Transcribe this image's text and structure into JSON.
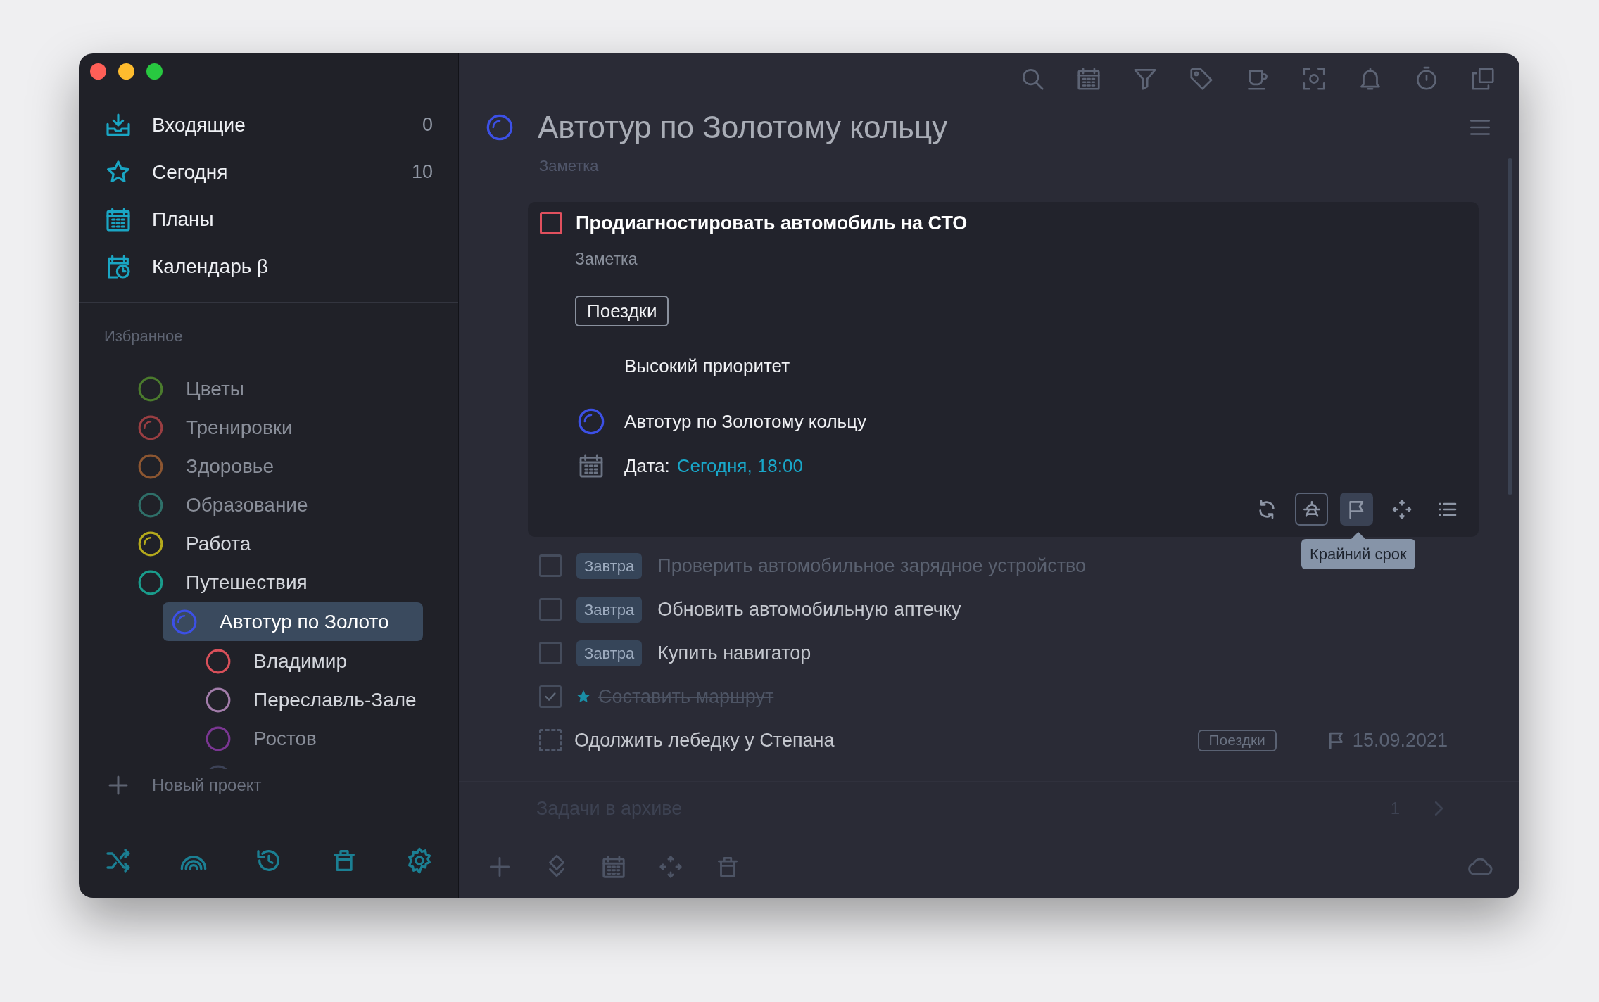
{
  "sidebar": {
    "nav": [
      {
        "kind": "inbox",
        "label": "Входящие",
        "count": "0",
        "selected": false
      },
      {
        "kind": "today",
        "label": "Сегодня",
        "count": "10",
        "selected": false
      },
      {
        "kind": "plans",
        "label": "Планы",
        "selected": false
      },
      {
        "kind": "calendar",
        "label": "Календарь β",
        "selected": false
      }
    ],
    "favorites_title": "Избранное",
    "projects": [
      {
        "kind": "plain",
        "label": "Цветы",
        "color": "#4b7b2d",
        "dimmed": true,
        "selected": false
      },
      {
        "kind": "started",
        "label": "Тренировки",
        "color": "#9a3e42",
        "dimmed": true,
        "selected": false
      },
      {
        "kind": "plain",
        "label": "Здоровье",
        "color": "#8c5631",
        "dimmed": true,
        "selected": false
      },
      {
        "kind": "plain",
        "label": "Образование",
        "color": "#2f7069",
        "dimmed": true,
        "selected": false
      },
      {
        "kind": "started",
        "label": "Работа",
        "color": "#b5aa1c",
        "dimmed": false,
        "selected": false
      },
      {
        "kind": "plain",
        "label": "Путешествия",
        "color": "#1a9c8c",
        "dimmed": false,
        "selected": false,
        "children": [
          {
            "kind": "started",
            "label": "Автотур по Золото",
            "color": "#3c50e6",
            "selected": true,
            "children": [
              {
                "kind": "plain",
                "label": "Владимир",
                "color": "#d9505a",
                "dimmed": false,
                "selected": false
              },
              {
                "kind": "plain",
                "label": "Переславль-Зале",
                "color": "#a27caa",
                "dimmed": false,
                "selected": false
              },
              {
                "kind": "plain",
                "label": "Ростов",
                "color": "#7a3692",
                "dimmed": true,
                "selected": false
              },
              {
                "kind": "plain",
                "color": "#3c4256",
                "selected": false
              }
            ]
          }
        ]
      }
    ],
    "new_project": "Новый проект"
  },
  "project": {
    "title": "Автотур по Золотому кольцу",
    "kind": "started",
    "color": "#3c50e6",
    "note": "Заметка"
  },
  "expanded_task": {
    "title": "Продиагностировать автомобиль на СТО",
    "checked": false,
    "color": "#e0505e",
    "note": "Заметка",
    "tag": "Поездки",
    "priority_label": "Высокий приоритет",
    "project": {
      "label": "Автотур по Золотому кольцу",
      "kind": "started",
      "color": "#3c50e6"
    },
    "date_label": "Дата:",
    "date_value": "Сегодня, 18:00",
    "actions": [
      {
        "kind": "repeat",
        "outlined": false,
        "highlighted": false
      },
      {
        "kind": "reminder",
        "outlined": true,
        "highlighted": false
      },
      {
        "kind": "deadline",
        "outlined": false,
        "highlighted": true,
        "tooltip": "Крайний срок"
      },
      {
        "kind": "move",
        "outlined": false,
        "highlighted": false
      },
      {
        "kind": "checklist",
        "outlined": false,
        "highlighted": false
      }
    ]
  },
  "tasks": [
    {
      "kind": "task",
      "title": "Проверить автомобильное зарядное устройство",
      "badge": "Завтра",
      "checked": false,
      "starred": false,
      "dimmed": true
    },
    {
      "kind": "task",
      "title": "Обновить автомобильную аптечку",
      "badge": "Завтра",
      "checked": false,
      "starred": false,
      "dimmed": false
    },
    {
      "kind": "task",
      "title": "Купить навигатор",
      "badge": "Завтра",
      "checked": false,
      "starred": false,
      "dimmed": false
    },
    {
      "kind": "task",
      "title": "Составить маршрут",
      "checked": true,
      "starred": true
    },
    {
      "kind": "someday",
      "title": "Одолжить лебедку у Степана",
      "checked": false,
      "starred": false,
      "dimmed": false,
      "tag": "Поездки",
      "deadline": "15.09.2021"
    }
  ],
  "archive": {
    "label": "Задачи в архиве",
    "count": "1"
  }
}
